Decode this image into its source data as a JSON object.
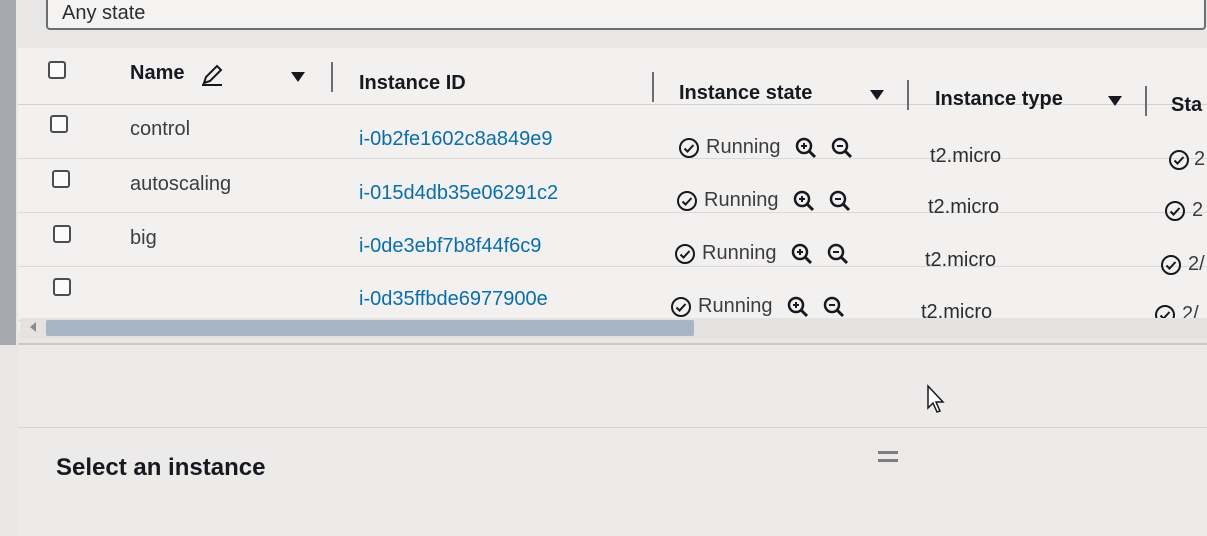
{
  "filter": {
    "value": "Any state"
  },
  "table": {
    "columns": [
      "Name",
      "Instance ID",
      "Instance state",
      "Instance type",
      "Sta"
    ],
    "rows": [
      {
        "name": "control",
        "instance_id": "i-0b2fe1602c8a849e9",
        "state": "Running",
        "type": "t2.micro",
        "status": "2"
      },
      {
        "name": "autoscaling",
        "instance_id": "i-015d4db35e06291c2",
        "state": "Running",
        "type": "t2.micro",
        "status": "2"
      },
      {
        "name": "big",
        "instance_id": "i-0de3ebf7b8f44f6c9",
        "state": "Running",
        "type": "t2.micro",
        "status": "2/"
      },
      {
        "name": "",
        "instance_id": "i-0d35ffbde6977900e",
        "state": "Running",
        "type": "t2.micro",
        "status": "2/"
      }
    ]
  },
  "details": {
    "title": "Select an instance"
  },
  "icons": {
    "edit": "pencil-icon",
    "sort": "caret-down-icon",
    "state": "check-circle-icon",
    "zoom_in": "zoom-in-icon",
    "zoom_out": "zoom-out-icon",
    "resize": "drag-handle-icon"
  },
  "colors": {
    "link": "#0a6ea8",
    "scrollbar_thumb": "#a7b5c5",
    "text": "#16191f"
  }
}
